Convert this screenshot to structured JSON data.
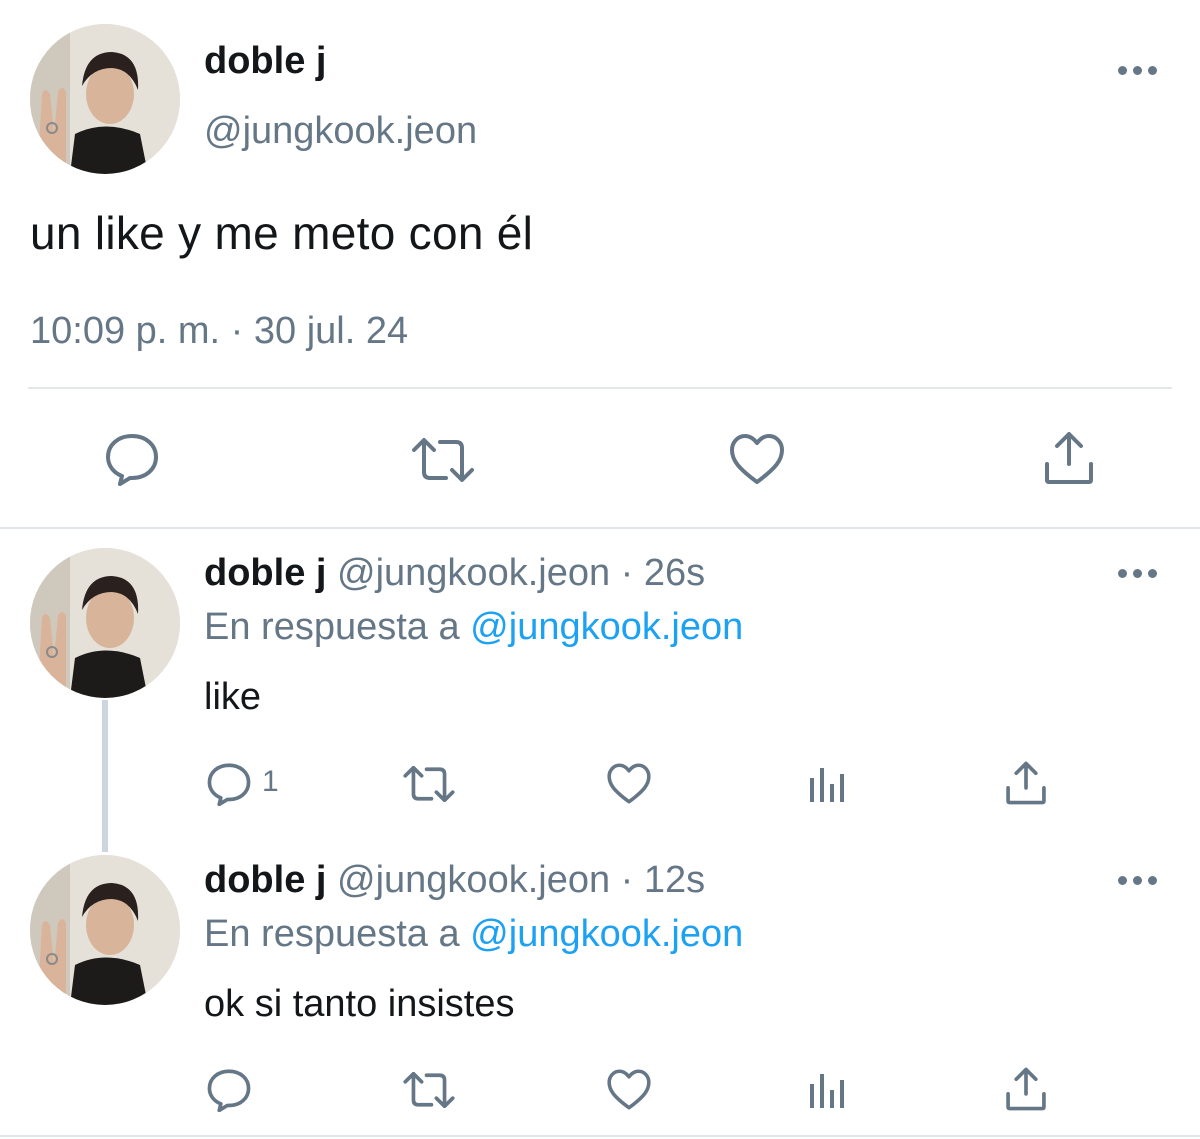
{
  "main_tweet": {
    "display_name": "doble j",
    "handle": "@jungkook.jeon",
    "text": "un like y me meto con él",
    "timestamp": "10:09 p. m. · 30 jul. 24",
    "avatar_icon": "avatar-photo",
    "actions": [
      "reply-icon",
      "retweet-icon",
      "like-icon",
      "share-icon"
    ]
  },
  "replies": [
    {
      "display_name": "doble j",
      "handle_time": "@jungkook.jeon · 26s",
      "replying_prefix": "En respuesta a ",
      "replying_to": "@jungkook.jeon",
      "text": "like",
      "reply_count": "1",
      "actions": [
        "reply-icon",
        "retweet-icon",
        "like-icon",
        "analytics-icon",
        "share-icon"
      ]
    },
    {
      "display_name": "doble j",
      "handle_time": "@jungkook.jeon · 12s",
      "replying_prefix": "En respuesta a ",
      "replying_to": "@jungkook.jeon",
      "text": "ok si tanto insistes",
      "reply_count": "",
      "actions": [
        "reply-icon",
        "retweet-icon",
        "like-icon",
        "analytics-icon",
        "share-icon"
      ]
    }
  ],
  "colors": {
    "text": "#14171a",
    "secondary": "#657786",
    "link": "#1da1f2",
    "divider": "#e1e8ed"
  }
}
